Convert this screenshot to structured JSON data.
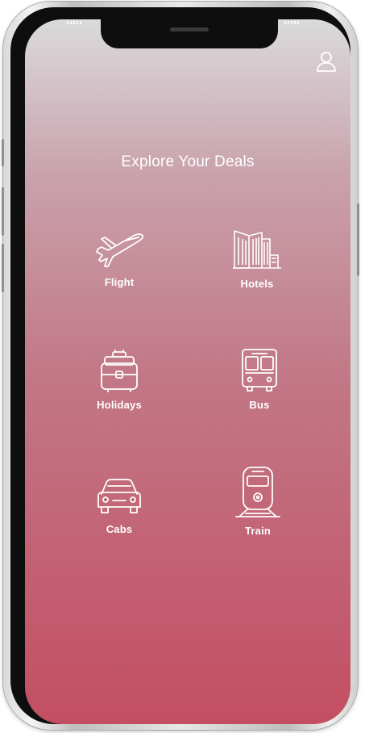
{
  "app": {
    "title": "Explore Your Deals"
  },
  "header": {
    "profile_icon": "user-icon"
  },
  "categories": [
    {
      "label": "Flight",
      "icon": "airplane-icon"
    },
    {
      "label": "Hotels",
      "icon": "hotel-icon"
    },
    {
      "label": "Holidays",
      "icon": "suitcase-icon"
    },
    {
      "label": "Bus",
      "icon": "bus-icon"
    },
    {
      "label": "Cabs",
      "icon": "car-icon"
    },
    {
      "label": "Train",
      "icon": "train-icon"
    }
  ],
  "colors": {
    "gradient_top": "#dadadc",
    "gradient_bottom": "#c34e62",
    "text": "#ffffff",
    "frame": "#0e0e0e"
  }
}
